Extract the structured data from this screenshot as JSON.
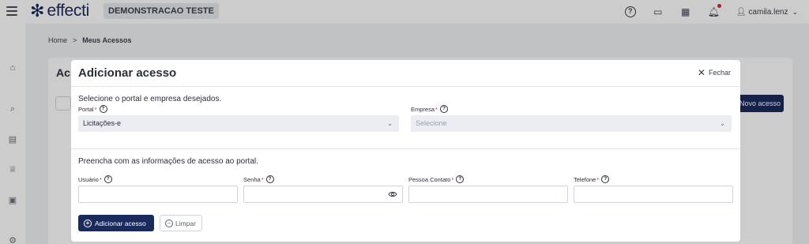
{
  "topbar": {
    "brand": "effecti",
    "environment": "DEMONSTRACAO TESTE",
    "user_name": "camila.lenz",
    "icons": [
      "help-icon",
      "screen-icon",
      "apps-icon",
      "bell-icon"
    ]
  },
  "breadcrumb": {
    "home": "Home",
    "separator": ">",
    "current": "Meus Acessos"
  },
  "background": {
    "title": "Ac",
    "new_button": "Novo acesso"
  },
  "modal": {
    "title": "Adicionar acesso",
    "close_label": "Fechar",
    "section1_title": "Selecione o portal e empresa desejados.",
    "portal_label": "Portal",
    "portal_value": "Licitações-e",
    "empresa_label": "Empresa",
    "empresa_placeholder": "Selecione",
    "section2_title": "Preencha com as informações de acesso ao portal.",
    "usuario_label": "Usuário",
    "senha_label": "Senha",
    "contato_label": "Pessoa Contato",
    "telefone_label": "Telefone",
    "required_mark": "*",
    "add_button": "Adicionar acesso",
    "clear_button": "Limpar"
  },
  "colors": {
    "primary": "#1b2a5c",
    "required": "#d0263a",
    "notification": "#d0263a"
  }
}
